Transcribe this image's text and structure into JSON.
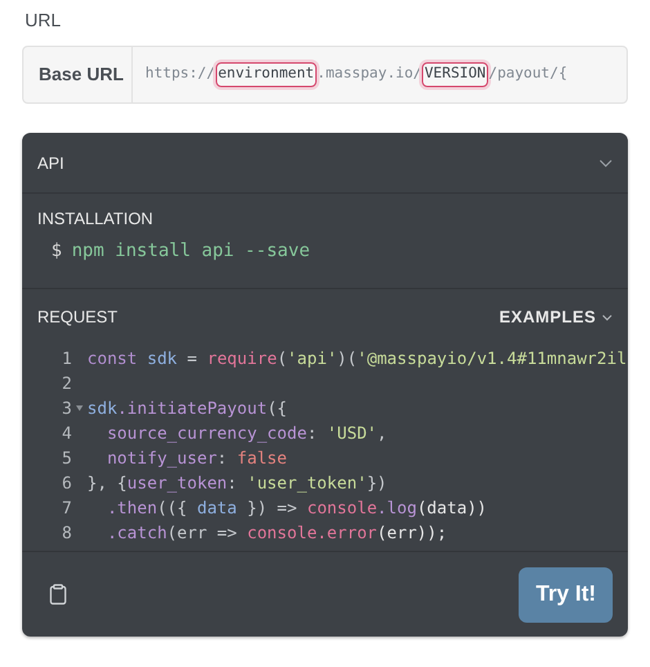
{
  "url_section": {
    "title": "URL",
    "base_url": {
      "label": "Base URL",
      "segments": [
        {
          "text": "https://",
          "highlighted": false
        },
        {
          "text": "environment",
          "highlighted": true
        },
        {
          "text": ".masspay.io/",
          "highlighted": false
        },
        {
          "text": "VERSION",
          "highlighted": true
        },
        {
          "text": "/payout/{",
          "highlighted": false
        }
      ]
    }
  },
  "panel": {
    "header": {
      "title": "API",
      "expanded": false
    },
    "installation": {
      "title": "INSTALLATION",
      "prompt": "$",
      "command": "npm install api --save"
    },
    "request": {
      "title": "REQUEST",
      "examples_label": "EXAMPLES",
      "lines": [
        {
          "number": "1",
          "foldable": false,
          "tokens": [
            {
              "text": "const ",
              "kind": "keyword"
            },
            {
              "text": "sdk",
              "kind": "variable"
            },
            {
              "text": " = ",
              "kind": "punct"
            },
            {
              "text": "require",
              "kind": "function"
            },
            {
              "text": "(",
              "kind": "punct"
            },
            {
              "text": "'api'",
              "kind": "string"
            },
            {
              "text": ")(",
              "kind": "punct"
            },
            {
              "text": "'@masspayio/v1.4#11mnawr2il",
              "kind": "string"
            }
          ]
        },
        {
          "number": "2",
          "foldable": false
        },
        {
          "number": "3",
          "foldable": true,
          "tokens": [
            {
              "text": "sdk",
              "kind": "variable"
            },
            {
              "text": ".initiatePayout",
              "kind": "property"
            },
            {
              "text": "({",
              "kind": "punct"
            }
          ]
        },
        {
          "number": "4",
          "foldable": false,
          "tokens": [
            {
              "text": "  source_currency_code",
              "kind": "property"
            },
            {
              "text": ": ",
              "kind": "punct"
            },
            {
              "text": "'USD'",
              "kind": "string"
            },
            {
              "text": ",",
              "kind": "punct"
            }
          ]
        },
        {
          "number": "5",
          "foldable": false,
          "tokens": [
            {
              "text": "  notify_user",
              "kind": "property"
            },
            {
              "text": ": ",
              "kind": "punct"
            },
            {
              "text": "false",
              "kind": "literal"
            }
          ]
        },
        {
          "number": "6",
          "foldable": false,
          "tokens": [
            {
              "text": "}, {",
              "kind": "punct"
            },
            {
              "text": "user_token",
              "kind": "property"
            },
            {
              "text": ": ",
              "kind": "punct"
            },
            {
              "text": "'user_token'",
              "kind": "string"
            },
            {
              "text": "})",
              "kind": "punct"
            }
          ]
        },
        {
          "number": "7",
          "foldable": false,
          "tokens": [
            {
              "text": "  .then",
              "kind": "property"
            },
            {
              "text": "(({ ",
              "kind": "punct"
            },
            {
              "text": "data",
              "kind": "variable"
            },
            {
              "text": " }) => ",
              "kind": "punct"
            },
            {
              "text": "console",
              "kind": "function"
            },
            {
              "text": ".log",
              "kind": "property"
            },
            {
              "text": "(data))",
              "kind": "plain"
            }
          ]
        },
        {
          "number": "8",
          "foldable": false,
          "tokens": [
            {
              "text": "  .catch",
              "kind": "property"
            },
            {
              "text": "(err => ",
              "kind": "punct"
            },
            {
              "text": "console",
              "kind": "function"
            },
            {
              "text": ".error",
              "kind": "function"
            },
            {
              "text": "(err));",
              "kind": "plain"
            }
          ]
        }
      ]
    },
    "footer": {
      "button": "Try It!"
    }
  }
}
